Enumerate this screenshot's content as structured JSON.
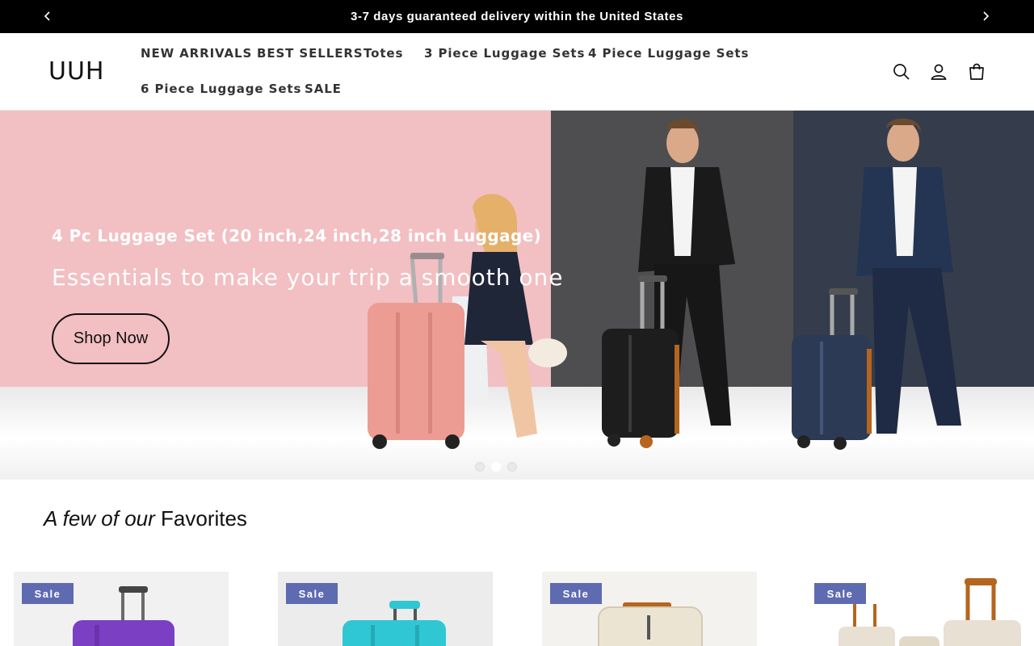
{
  "announcement": {
    "message": "3-7 days guaranteed delivery within the United States",
    "prev_icon": "chevron-left-icon",
    "next_icon": "chevron-right-icon"
  },
  "header": {
    "logo": "UUH",
    "nav": [
      {
        "label": "NEW ARRIVALS"
      },
      {
        "label": "BEST SELLERS"
      },
      {
        "label": "Totes"
      },
      {
        "label": "3 Piece Luggage Sets"
      },
      {
        "label": "4 Piece Luggage Sets"
      },
      {
        "label": "6 Piece Luggage Sets"
      },
      {
        "label": "SALE"
      }
    ],
    "icons": [
      "search-icon",
      "account-icon",
      "cart-icon"
    ]
  },
  "hero": {
    "subtitle": "4 Pc Luggage Set (20 inch,24 inch,28 inch Luggage)",
    "title": "Essentials to make your trip a smooth one",
    "cta": "Shop Now",
    "slide_count": 3,
    "active_slide": 2
  },
  "favorites": {
    "heading_italic": "A few of our",
    "heading_rest": "Favorites",
    "products": [
      {
        "badge": "Sale",
        "color": "#7b3fc4"
      },
      {
        "badge": "Sale",
        "color": "#2ec7d3"
      },
      {
        "badge": "Sale",
        "color": "#ece4d3"
      },
      {
        "badge": "Sale",
        "color": "#e8e0d2"
      }
    ]
  },
  "colors": {
    "announcement_bg": "#000000",
    "hero_pink": "#f2bfc3",
    "hero_grey": "#4e4e50",
    "hero_navy": "#353d4c",
    "sale_badge": "#5f6bb0"
  }
}
